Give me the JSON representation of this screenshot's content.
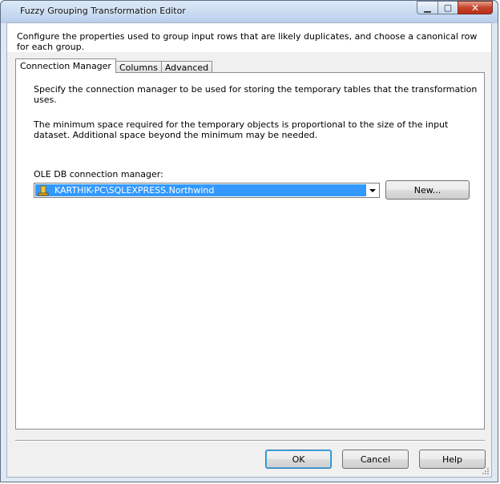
{
  "window": {
    "title": "Fuzzy Grouping Transformation Editor",
    "description": "Configure the properties used to group input rows that are likely duplicates, and choose a canonical row for each group."
  },
  "tabs": [
    {
      "label": "Connection Manager",
      "active": true
    },
    {
      "label": "Columns",
      "active": false
    },
    {
      "label": "Advanced",
      "active": false
    }
  ],
  "connection_tab": {
    "intro": "Specify the connection manager to be used for storing the temporary tables that the transformation uses.",
    "space_note": "The minimum space required for the temporary objects is proportional to the size of the input dataset. Additional space beyond the minimum may be needed.",
    "cm_label": "OLE DB connection manager:",
    "cm_value": "KARTHIK-PC\\SQLEXPRESS.Northwind",
    "new_button": "New..."
  },
  "footer": {
    "ok": "OK",
    "cancel": "Cancel",
    "help": "Help"
  },
  "icons": {
    "minimize": "minimize-icon",
    "maximize": "maximize-icon",
    "close": "close-icon",
    "connection": "database-connection-icon",
    "dropdown": "chevron-down-icon"
  },
  "colors": {
    "selection": "#3399ff",
    "close_button": "#c4452c"
  }
}
